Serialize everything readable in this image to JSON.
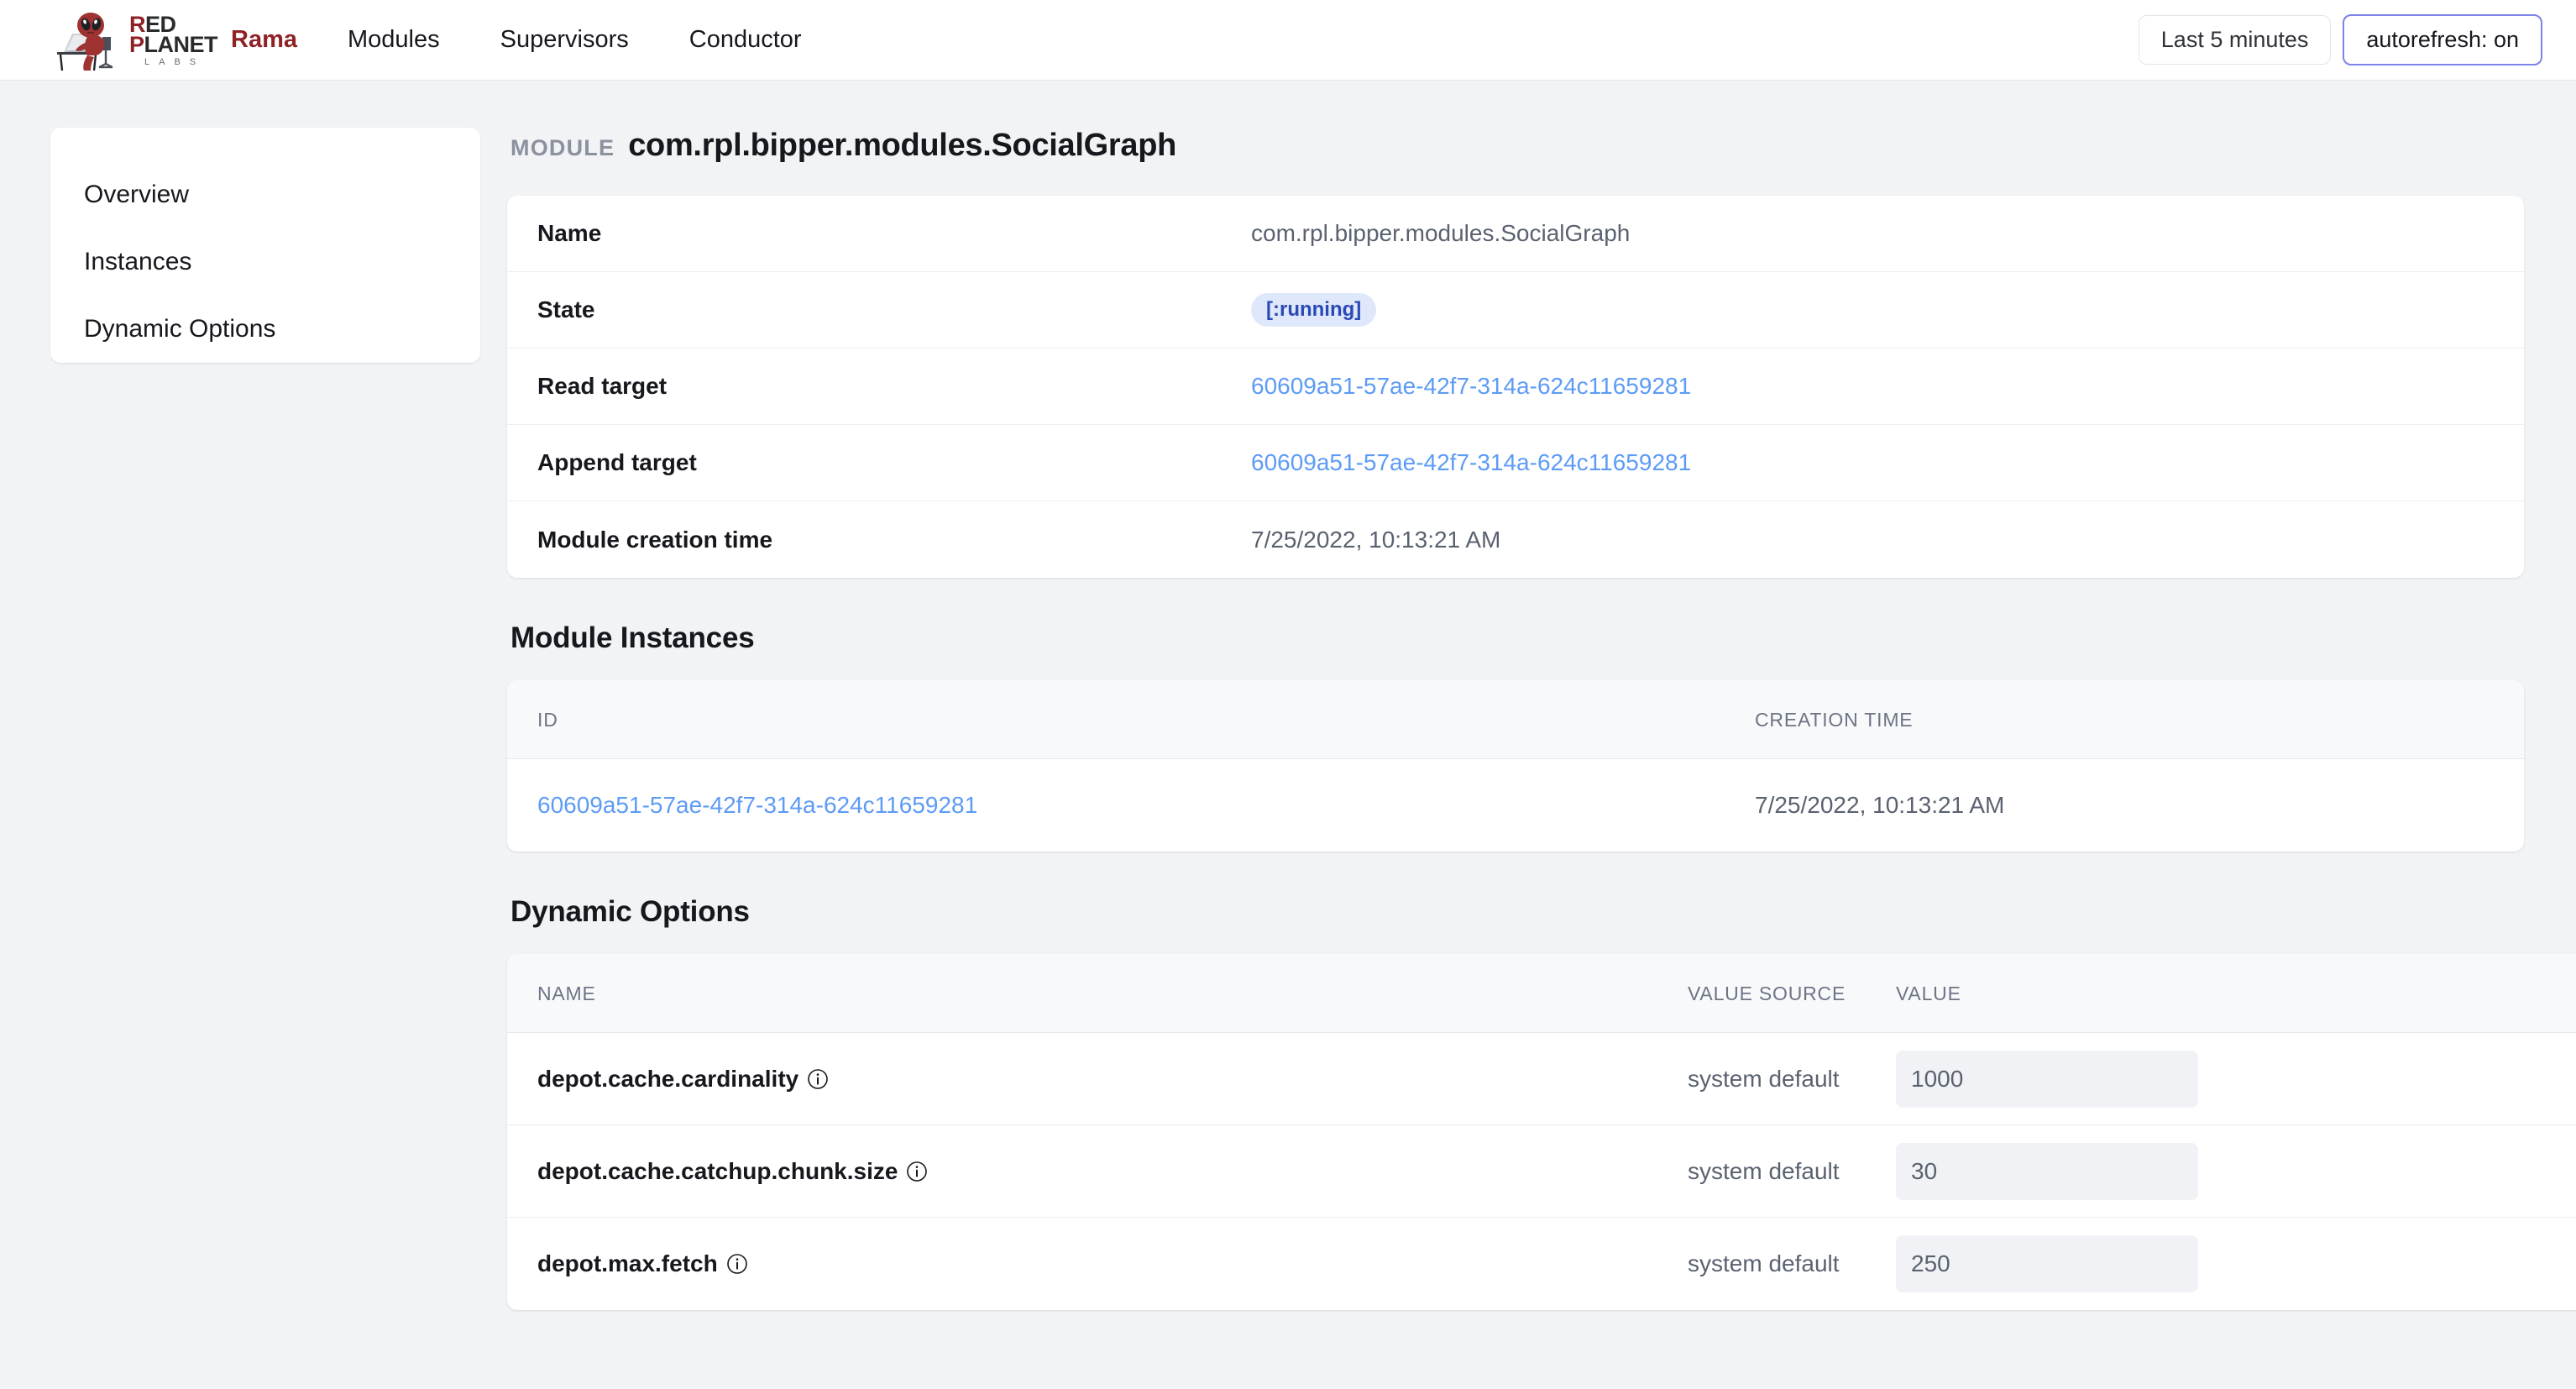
{
  "topnav": {
    "brand_logo_line1_a": "R",
    "brand_logo_line1_b": "ED",
    "brand_logo_line2_a": "P",
    "brand_logo_line2_b": "LANET",
    "brand_logo_sub": "LABS",
    "product_name": "Rama",
    "links": [
      {
        "label": "Modules"
      },
      {
        "label": "Supervisors"
      },
      {
        "label": "Conductor"
      }
    ],
    "time_range_label": "Last 5 minutes",
    "autorefresh_label": "autorefresh: on"
  },
  "sidebar": {
    "items": [
      {
        "label": "Overview"
      },
      {
        "label": "Instances"
      },
      {
        "label": "Dynamic Options"
      }
    ]
  },
  "header": {
    "kicker": "MODULE",
    "title": "com.rpl.bipper.modules.SocialGraph"
  },
  "overview": {
    "rows": [
      {
        "label": "Name",
        "value": "com.rpl.bipper.modules.SocialGraph",
        "kind": "text"
      },
      {
        "label": "State",
        "value": "[:running]",
        "kind": "badge"
      },
      {
        "label": "Read target",
        "value": "60609a51-57ae-42f7-314a-624c11659281",
        "kind": "link"
      },
      {
        "label": "Append target",
        "value": "60609a51-57ae-42f7-314a-624c11659281",
        "kind": "link"
      },
      {
        "label": "Module creation time",
        "value": "7/25/2022, 10:13:21 AM",
        "kind": "text"
      }
    ]
  },
  "instances": {
    "title": "Module Instances",
    "columns": {
      "id": "ID",
      "creation_time": "CREATION TIME"
    },
    "rows": [
      {
        "id": "60609a51-57ae-42f7-314a-624c11659281",
        "creation_time": "7/25/2022, 10:13:21 AM"
      }
    ]
  },
  "dynamic_options": {
    "title": "Dynamic Options",
    "columns": {
      "name": "NAME",
      "value_source": "VALUE SOURCE",
      "value": "VALUE"
    },
    "rows": [
      {
        "name": "depot.cache.cardinality",
        "info_icon": "info-icon",
        "value_source": "system default",
        "value": "1000"
      },
      {
        "name": "depot.cache.catchup.chunk.size",
        "info_icon": "info-icon",
        "value_source": "system default",
        "value": "30"
      },
      {
        "name": "depot.max.fetch",
        "info_icon": "info-icon",
        "value_source": "system default",
        "value": "250"
      }
    ]
  },
  "colors": {
    "brand_red": "#8f2226",
    "link_blue": "#5d9bf5",
    "badge_bg": "#dfe7fb",
    "badge_text": "#2b49b5",
    "accent_outline": "#7b84e8",
    "page_bg": "#f1f3f5"
  }
}
